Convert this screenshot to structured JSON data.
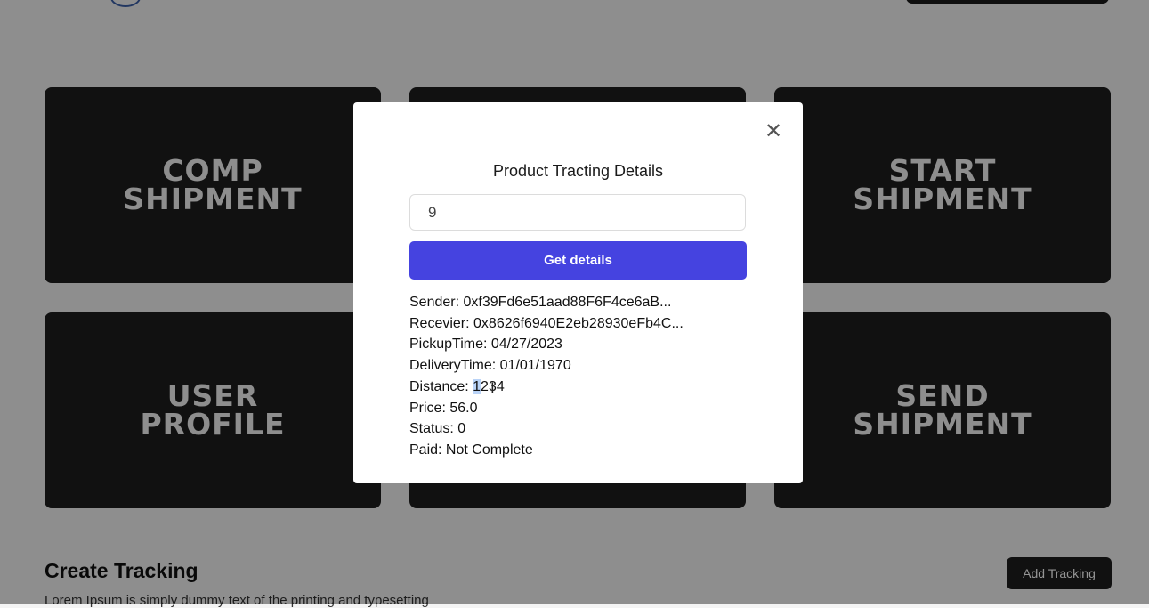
{
  "cards": [
    {
      "line1": "COMP",
      "line2": "SHIPMENT"
    },
    {
      "line1": "START",
      "line2": "SHIPMENT"
    },
    {
      "line1": "USER",
      "line2": "PROFILE"
    },
    {
      "line1": "SEND",
      "line2": "SHIPMENT"
    }
  ],
  "section": {
    "title": "Create Tracking",
    "description": "Lorem Ipsum is simply dummy text of the printing and typesetting",
    "add_button": "Add Tracking"
  },
  "modal": {
    "title": "Product Tracting Details",
    "input_value": "9",
    "button": "Get details",
    "close_glyph": "✕",
    "details": {
      "sender": "Sender: 0xf39Fd6e51aad88F6F4ce6aB...",
      "receiver": "Recevier: 0x8626f6940E2eb28930eFb4C...",
      "pickup": "PickupTime: 04/27/2023",
      "delivery": "DeliveryTime: 01/01/1970",
      "distance_label": "Distance: ",
      "distance_highlight": "1",
      "distance_rest": "234",
      "price": "Price: 56.0",
      "status": "Status: 0",
      "paid": "Paid: Not Complete"
    }
  },
  "colors": {
    "accent": "#4543e0",
    "card_bg": "#1e1e1e",
    "selection": "#b9d3f7"
  }
}
